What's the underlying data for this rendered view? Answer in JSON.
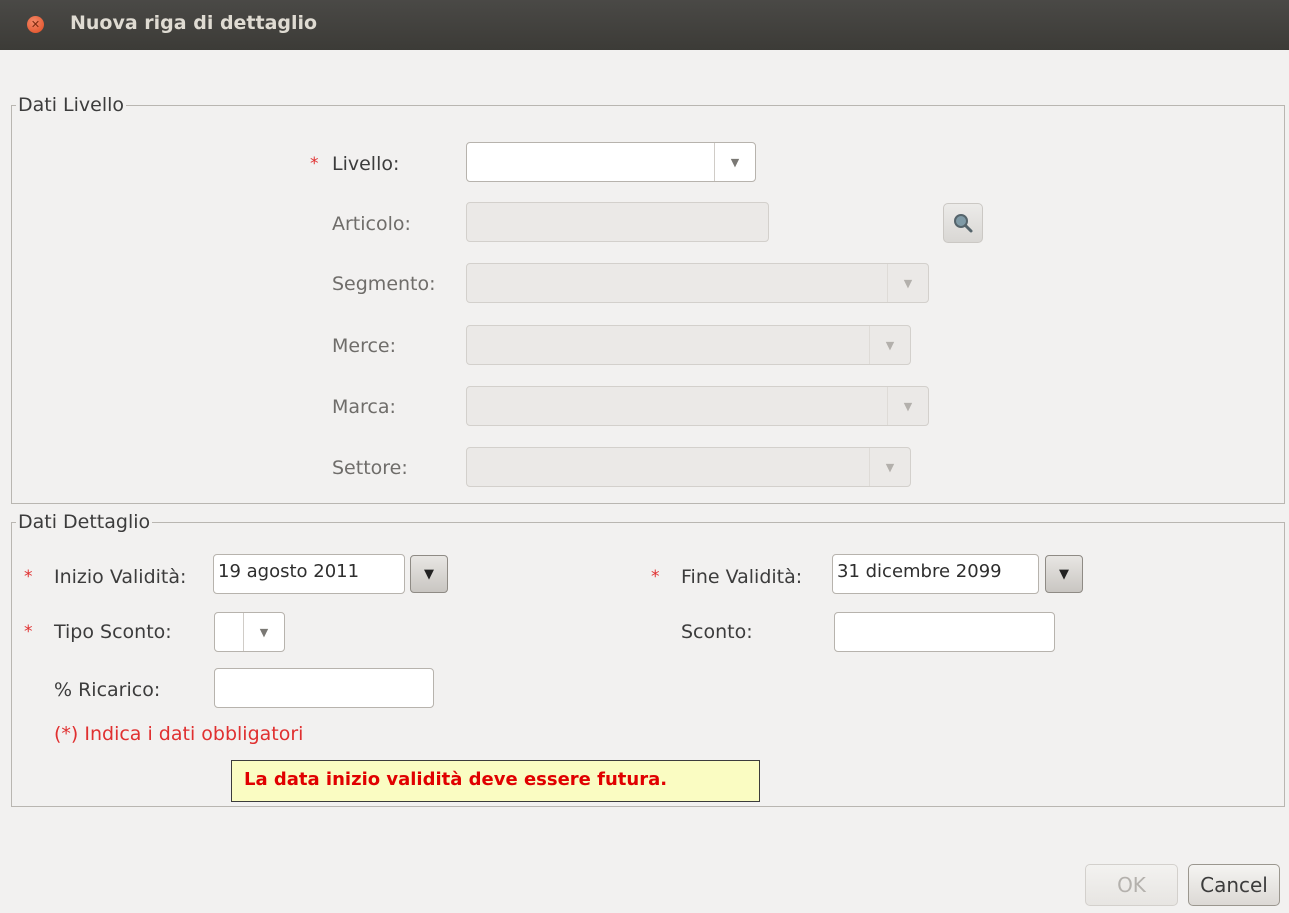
{
  "window": {
    "title": "Nuova riga di dettaglio"
  },
  "dati_livello": {
    "legend": "Dati Livello",
    "livello": {
      "label": "Livello:",
      "value": ""
    },
    "articolo": {
      "label": "Articolo:",
      "value": ""
    },
    "segmento": {
      "label": "Segmento:",
      "value": ""
    },
    "merce": {
      "label": "Merce:",
      "value": ""
    },
    "marca": {
      "label": "Marca:",
      "value": ""
    },
    "settore": {
      "label": "Settore:",
      "value": ""
    }
  },
  "dati_dettaglio": {
    "legend": "Dati Dettaglio",
    "inizio_validita": {
      "label": "Inizio Validità:",
      "value": "19 agosto 2011"
    },
    "fine_validita": {
      "label": "Fine Validità:",
      "value": "31 dicembre 2099"
    },
    "tipo_sconto": {
      "label": "Tipo Sconto:",
      "value": ""
    },
    "sconto": {
      "label": "Sconto:",
      "value": ""
    },
    "ricarico": {
      "label": "% Ricarico:",
      "value": ""
    },
    "required_note": "(*) Indica i dati obbligatori",
    "error_message": "La data inizio validità deve essere futura."
  },
  "required_marker": "*",
  "buttons": {
    "ok": "OK",
    "cancel": "Cancel"
  },
  "icons": {
    "close": "close-icon",
    "search": "search-icon",
    "dropdown": "chevron-down-icon"
  },
  "colors": {
    "required": "#e03030",
    "error_text": "#e00000",
    "error_bg": "#fafcc2",
    "titlebar": "#3c3b37"
  }
}
